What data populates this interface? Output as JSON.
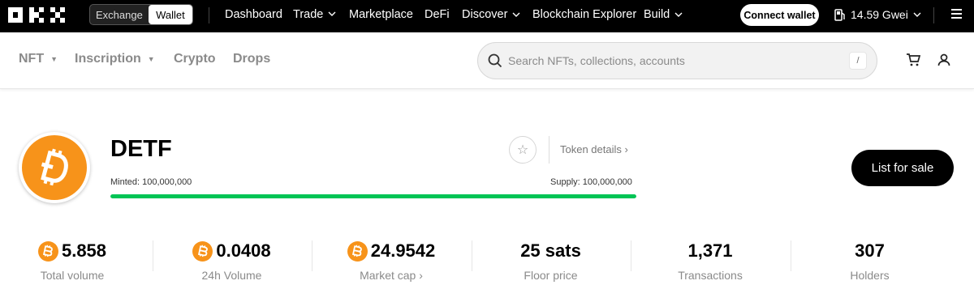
{
  "topbar": {
    "brand": "OKX",
    "mode_tabs": [
      "Exchange",
      "Wallet"
    ],
    "nav": [
      {
        "label": "Dashboard",
        "dropdown": false
      },
      {
        "label": "Trade",
        "dropdown": true
      },
      {
        "label": "Marketplace",
        "dropdown": false
      },
      {
        "label": "DeFi",
        "dropdown": false
      },
      {
        "label": "Discover",
        "dropdown": true
      },
      {
        "label": "Blockchain Explorer",
        "dropdown": false
      },
      {
        "label": "Build",
        "dropdown": true
      }
    ],
    "connect_wallet": "Connect wallet",
    "gas": "14.59 Gwei"
  },
  "subnav": {
    "items": [
      {
        "label": "NFT",
        "dropdown": true
      },
      {
        "label": "Inscription",
        "dropdown": true
      },
      {
        "label": "Crypto",
        "dropdown": false
      },
      {
        "label": "Drops",
        "dropdown": false
      }
    ],
    "search_placeholder": "Search NFTs, collections, accounts",
    "search_shortcut": "/"
  },
  "token": {
    "name": "DETF",
    "details_link": "Token details",
    "minted_label": "Minted: 100,000,000",
    "supply_label": "Supply: 100,000,000",
    "minted_fraction": 1.0,
    "list_button": "List for sale",
    "icon_color": "#f7931a",
    "progress_color": "#00c455"
  },
  "stats": [
    {
      "value": "5.858",
      "label": "Total volume",
      "btc_icon": true,
      "link": false
    },
    {
      "value": "0.0408",
      "label": "24h Volume",
      "btc_icon": true,
      "link": false
    },
    {
      "value": "24.9542",
      "label": "Market cap",
      "btc_icon": true,
      "link": true
    },
    {
      "value": "25 sats",
      "label": "Floor price",
      "btc_icon": false,
      "link": false
    },
    {
      "value": "1,371",
      "label": "Transactions",
      "btc_icon": false,
      "link": false
    },
    {
      "value": "307",
      "label": "Holders",
      "btc_icon": false,
      "link": false
    }
  ]
}
